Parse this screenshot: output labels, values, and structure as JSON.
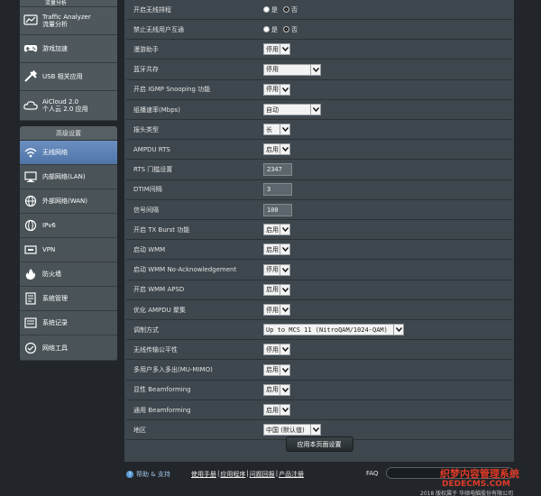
{
  "sidebar": {
    "general": [
      {
        "icon": "traffic-icon",
        "label": "流量分析 ",
        "partial": true
      },
      {
        "icon": "traffic-analyzer-icon",
        "label": "Traffic Analyzer",
        "sub": "流量分析"
      },
      {
        "icon": "gamepad-icon",
        "label": "游戏加速"
      },
      {
        "icon": "usb-icon",
        "label": "USB 相关应用"
      },
      {
        "icon": "cloud-icon",
        "label": "AiCloud 2.0",
        "sub": "个人云 2.0 应用"
      }
    ],
    "advanced_title": "高级设置",
    "advanced": [
      {
        "icon": "wireless-icon",
        "label": "无线网络",
        "active": true
      },
      {
        "icon": "lan-icon",
        "label": "内部网络(LAN)"
      },
      {
        "icon": "wan-icon",
        "label": "外部网络(WAN)"
      },
      {
        "icon": "ipv6-icon",
        "label": "IPv6"
      },
      {
        "icon": "vpn-icon",
        "label": "VPN"
      },
      {
        "icon": "firewall-icon",
        "label": "防火墙"
      },
      {
        "icon": "admin-icon",
        "label": "系统管理"
      },
      {
        "icon": "log-icon",
        "label": "系统记录"
      },
      {
        "icon": "network-tools-icon",
        "label": "网络工具"
      }
    ]
  },
  "settings": [
    {
      "label": "开启无线排程",
      "type": "radio",
      "yes": "是",
      "no": "否",
      "selected": "no"
    },
    {
      "label": "禁止无线用户互通",
      "type": "radio",
      "yes": "是",
      "no": "否",
      "selected": "no"
    },
    {
      "label": "漫游助手",
      "type": "select",
      "value": "停用"
    },
    {
      "label": "蓝牙共存",
      "type": "select",
      "value": "停用",
      "wide": true
    },
    {
      "label": "开启 IGMP Snooping 功能",
      "type": "select",
      "value": "停用"
    },
    {
      "label": "组播速率(Mbps)",
      "type": "select",
      "value": "自动",
      "wide": true
    },
    {
      "label": "报头类型",
      "type": "select",
      "value": "长"
    },
    {
      "label": "AMPDU RTS",
      "type": "select",
      "value": "启用"
    },
    {
      "label": "RTS 门槛设置",
      "type": "input",
      "value": "2347"
    },
    {
      "label": "DTIM间隔",
      "type": "input",
      "value": "3"
    },
    {
      "label": "信号间隔",
      "type": "input",
      "value": "100"
    },
    {
      "label": "开启 TX Burst 功能",
      "type": "select",
      "value": "启用"
    },
    {
      "label": "启动 WMM",
      "type": "select",
      "value": "启用"
    },
    {
      "label": "启动 WMM No-Acknowledgement",
      "type": "select",
      "value": "停用"
    },
    {
      "label": "开启 WMM APSD",
      "type": "select",
      "value": "启用"
    },
    {
      "label": "优化 AMPDU 聚集",
      "type": "select",
      "value": "停用"
    },
    {
      "label": "调制方式",
      "type": "select",
      "value": "Up to MCS 11 (NitroQAM/1024-QAM)",
      "xwide": true
    },
    {
      "label": "无线传输公平性",
      "type": "select",
      "value": "停用"
    },
    {
      "label": "多用户多入多出(MU-MIMO)",
      "type": "select",
      "value": "启用"
    },
    {
      "label": "显性 Beamforming",
      "type": "select",
      "value": "启用"
    },
    {
      "label": "通用 Beamforming",
      "type": "select",
      "value": "启用"
    },
    {
      "label": "地区",
      "type": "select",
      "value": "中国 (默认值)",
      "wide": true
    }
  ],
  "apply_label": "应用本页面设置",
  "footer": {
    "help": "帮助 & 支持",
    "links": [
      "使用手册",
      "应用程序",
      "问题回报",
      "产品注册"
    ],
    "faq": "FAQ",
    "copyright": "2018 版权属于 华硕电脑股份有限公司"
  },
  "watermark": {
    "line1": "织梦内容管理系统",
    "line2": "DEDECMS.COM"
  }
}
